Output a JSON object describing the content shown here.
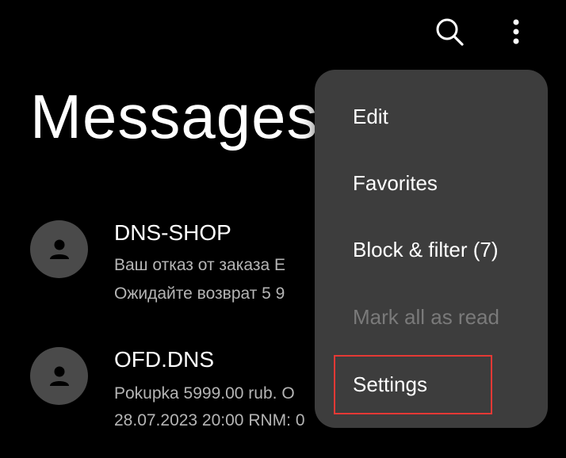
{
  "header": {
    "title": "Messages",
    "search_icon": "search-icon",
    "more_icon": "more-vert-icon"
  },
  "conversations": [
    {
      "name": "DNS-SHOP",
      "preview_line1": "Ваш отказ от заказа Е",
      "preview_line2": "Ожидайте возврат 5 9",
      "avatar_icon": "person-icon"
    },
    {
      "name": "OFD.DNS",
      "preview_line1": "Pokupka 5999.00 rub. О",
      "preview_line2": "28.07.2023 20:00 RNM: 0",
      "avatar_icon": "person-icon"
    }
  ],
  "menu": {
    "items": [
      {
        "label": "Edit",
        "enabled": true
      },
      {
        "label": "Favorites",
        "enabled": true
      },
      {
        "label": "Block & filter (7)",
        "enabled": true
      },
      {
        "label": "Mark all as read",
        "enabled": false
      },
      {
        "label": "Settings",
        "enabled": true,
        "highlighted": true
      }
    ]
  },
  "colors": {
    "background": "#000000",
    "menu_background": "#3d3d3d",
    "avatar_background": "#4a4a4a",
    "highlight": "#e53935",
    "disabled_text": "#7a7a7a"
  }
}
